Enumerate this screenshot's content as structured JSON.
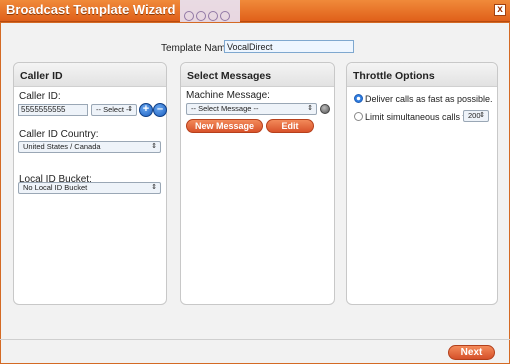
{
  "window": {
    "title": "Broadcast Template Wizard",
    "close_symbol": "x"
  },
  "template": {
    "label": "Template Name:",
    "value": "VocalDirect"
  },
  "caller_id_panel": {
    "heading": "Caller ID",
    "caller_id_label": "Caller ID:",
    "caller_id_value": "5555555555",
    "caller_id_select": "-- Select --",
    "country_label": "Caller ID Country:",
    "country_value": "United States / Canada",
    "bucket_label": "Local ID Bucket:",
    "bucket_value": "No Local ID Bucket",
    "add_symbol": "+",
    "remove_symbol": "–"
  },
  "messages_panel": {
    "heading": "Select Messages",
    "machine_label": "Machine Message:",
    "machine_select": "-- Select Message --",
    "new_button": "New Message",
    "edit_button": "Edit"
  },
  "throttle_panel": {
    "heading": "Throttle Options",
    "option_fast": "Deliver calls as fast as possible.",
    "option_limit": "Limit simultaneous calls to",
    "limit_value": "200",
    "selected_option": "fast"
  },
  "footer": {
    "next_button": "Next"
  },
  "colors": {
    "accent": "#e0601a",
    "select_blue": "#2f7de0"
  },
  "icons": {
    "arrow": "⇕",
    "speaker": "speaker-icon",
    "add": "plus-icon",
    "remove": "minus-icon"
  }
}
